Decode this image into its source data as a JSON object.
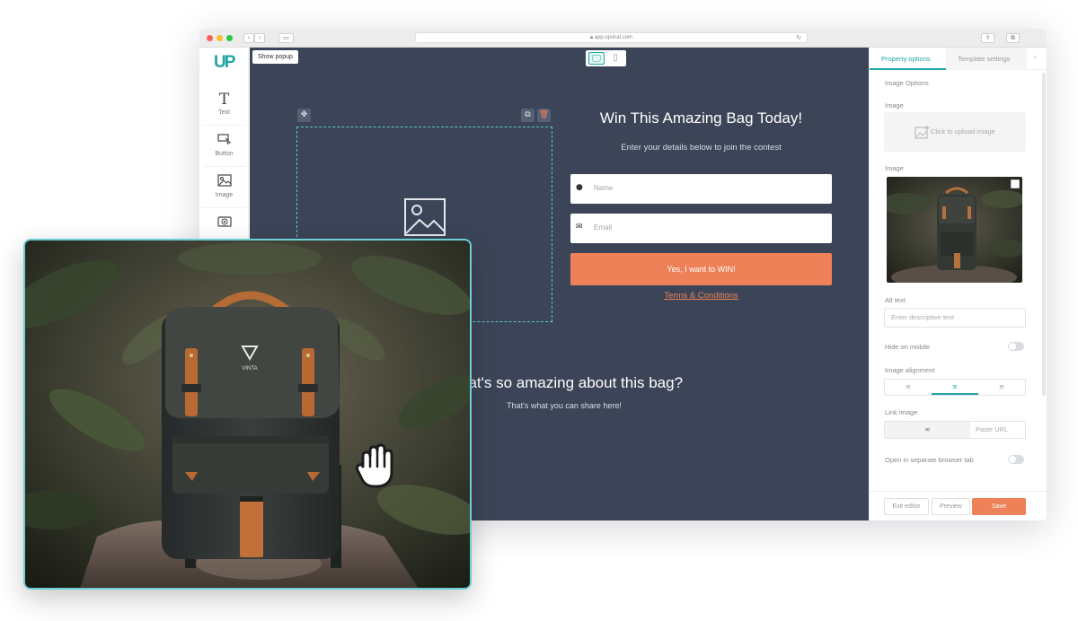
{
  "browser": {
    "url": "app.upviral.com",
    "traffic_lights": [
      "#ff5f57",
      "#febc2e",
      "#28c840"
    ]
  },
  "toolbox": {
    "logo": "UP",
    "items": [
      {
        "icon": "text-icon",
        "glyph": "T",
        "label": "Text"
      },
      {
        "icon": "button-icon",
        "glyph": "",
        "label": "Button"
      },
      {
        "icon": "image-icon",
        "glyph": "",
        "label": "Image"
      },
      {
        "icon": "video-icon",
        "glyph": "",
        "label": ""
      }
    ]
  },
  "canvas": {
    "show_popup_label": "Show popup",
    "popup_title": "Win This Amazing Bag Today!",
    "popup_subtitle": "Enter your details below to join the contest",
    "name_placeholder": "Name",
    "email_placeholder": "Email",
    "cta_label": "Yes, I want to WIN!",
    "terms_label": "Terms & Conditions",
    "section_title": "What's so amazing about this bag?",
    "section_subtitle": "That's what you can share here!",
    "accent_color": "#ee8157",
    "background_color": "#3c4558"
  },
  "panel": {
    "tabs": [
      {
        "label": "Property options",
        "active": true
      },
      {
        "label": "Template settings",
        "active": false
      }
    ],
    "image_options_label": "Image Options",
    "image_label_1": "Image",
    "upload_text": "Click to upload image",
    "image_label_2": "Image",
    "alt_text_label": "Alt text",
    "alt_text_placeholder": "Enter descriptive text",
    "hide_on_mobile_label": "Hide on mobile",
    "hide_on_mobile": false,
    "image_alignment_label": "Image alignment",
    "alignment_selected": "center",
    "link_image_label": "Link image",
    "link_icon": "link-icon",
    "paste_url_placeholder": "Paste URL",
    "open_new_tab_label": "Open in separate browser tab",
    "open_new_tab": false,
    "exit_editor_label": "Exit editor",
    "preview_label": "Preview",
    "save_label": "Save",
    "brand_color": "#1fa6a6"
  }
}
